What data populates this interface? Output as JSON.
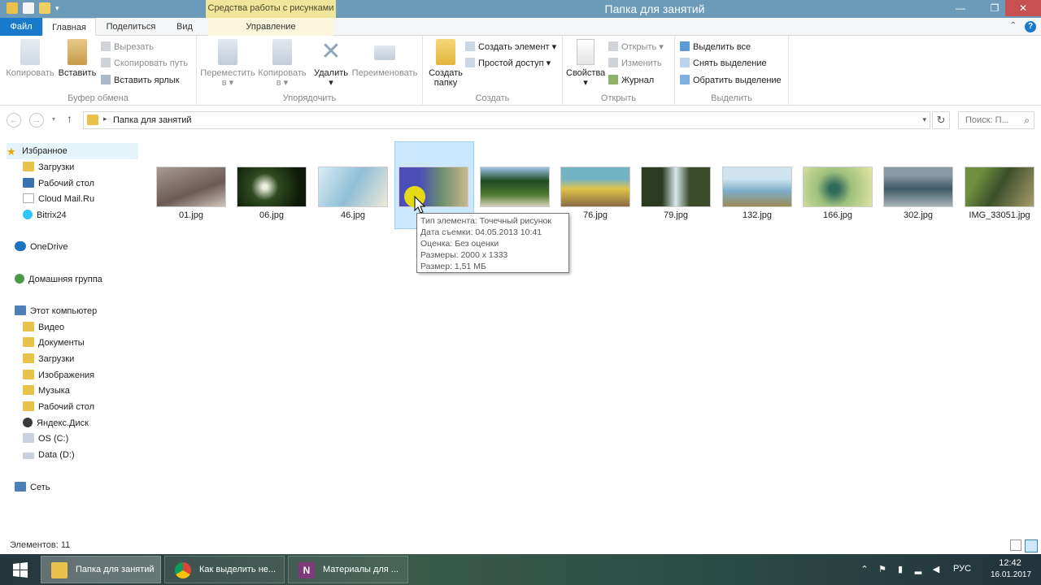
{
  "window": {
    "title": "Папка для занятий",
    "context_tab": "Средства работы с рисунками"
  },
  "tabs": {
    "file": "Файл",
    "home": "Главная",
    "share": "Поделиться",
    "view": "Вид",
    "manage": "Управление"
  },
  "ribbon": {
    "clipboard": {
      "label": "Буфер обмена",
      "copy": "Копировать",
      "paste": "Вставить",
      "cut": "Вырезать",
      "copy_path": "Скопировать путь",
      "paste_shortcut": "Вставить ярлык"
    },
    "organize": {
      "label": "Упорядочить",
      "move_to": "Переместить",
      "copy_to": "Копировать",
      "to": "в",
      "delete": "Удалить",
      "rename": "Переименовать"
    },
    "create": {
      "label": "Создать",
      "new_folder_1": "Создать",
      "new_folder_2": "папку",
      "new_item": "Создать элемент",
      "easy_access": "Простой доступ"
    },
    "open": {
      "label": "Открыть",
      "properties": "Свойства",
      "open": "Открыть",
      "edit": "Изменить",
      "history": "Журнал"
    },
    "select": {
      "label": "Выделить",
      "select_all": "Выделить все",
      "select_none": "Снять выделение",
      "invert": "Обратить выделение"
    }
  },
  "address": {
    "path": "Папка для занятий",
    "search_placeholder": "Поиск: П..."
  },
  "navpane": {
    "favorites": "Избранное",
    "fav_items": [
      "Загрузки",
      "Рабочий стол",
      "Cloud Mail.Ru",
      "Bitrix24"
    ],
    "onedrive": "OneDrive",
    "homegroup": "Домашняя группа",
    "this_pc": "Этот компьютер",
    "pc_items": [
      "Видео",
      "Документы",
      "Загрузки",
      "Изображения",
      "Музыка",
      "Рабочий стол",
      "Яндекс.Диск",
      "OS (C:)",
      "Data (D:)"
    ],
    "network": "Сеть"
  },
  "files": [
    {
      "name": "01.jpg"
    },
    {
      "name": "06.jpg"
    },
    {
      "name": "46.jpg"
    },
    {
      "name": ""
    },
    {
      "name": ""
    },
    {
      "name": "76.jpg"
    },
    {
      "name": "79.jpg"
    },
    {
      "name": "132.jpg"
    },
    {
      "name": "166.jpg"
    },
    {
      "name": "302.jpg"
    },
    {
      "name": "IMG_33051.jpg"
    }
  ],
  "tooltip": {
    "type": "Тип элемента: Точечный рисунок",
    "date": "Дата съемки: 04.05.2013 10:41",
    "rating": "Оценка: Без оценки",
    "dimensions": "Размеры: 2000 x 1333",
    "size": "Размер: 1,51 МБ"
  },
  "status": {
    "count": "Элементов: 11"
  },
  "taskbar": {
    "tasks": [
      "Папка для занятий",
      "Как выделить не...",
      "Материалы для ..."
    ],
    "lang": "РУС",
    "time": "12:42",
    "date": "16.01.2017"
  },
  "colors": {
    "accent": "#1979ca",
    "titlebar": "#6b9bb8",
    "context_tab": "#f1e49b",
    "selection": "#cce8ff"
  }
}
